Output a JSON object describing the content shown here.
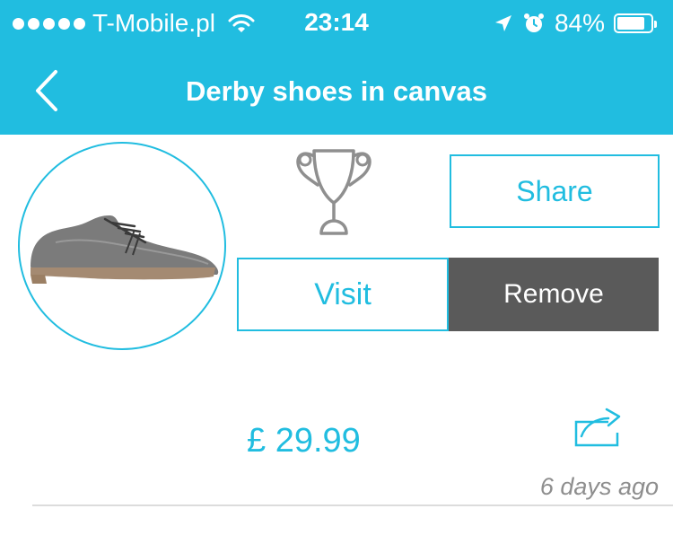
{
  "status_bar": {
    "carrier": "T-Mobile.pl",
    "time": "23:14",
    "battery": "84%",
    "battery_level": 0.84
  },
  "nav": {
    "title": "Derby shoes in canvas"
  },
  "actions": {
    "share_label": "Share",
    "visit_label": "Visit",
    "remove_label": "Remove"
  },
  "product": {
    "price": "£ 29.99",
    "added": "6 days ago"
  },
  "colors": {
    "accent": "#21bde0",
    "remove_bg": "#5a5a5a",
    "muted_text": "#8e8e8e"
  },
  "icons": [
    "back-chevron-icon",
    "trophy-icon",
    "share-icon",
    "wifi-icon",
    "location-arrow-icon",
    "alarm-icon",
    "battery-icon"
  ]
}
